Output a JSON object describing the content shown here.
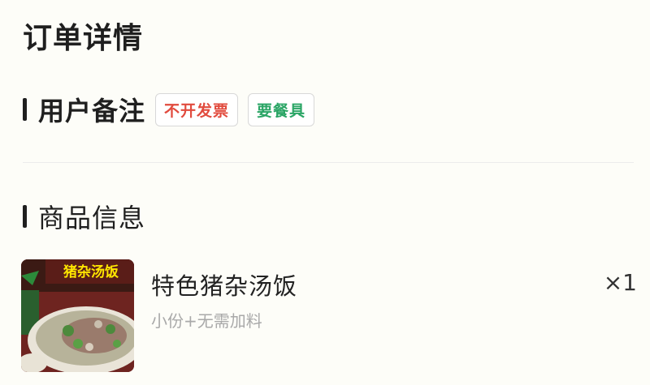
{
  "page": {
    "title": "订单详情"
  },
  "remark": {
    "title": "用户备注",
    "tags": [
      "不开发票",
      "要餐具"
    ]
  },
  "goods": {
    "title": "商品信息",
    "item": {
      "name": "特色猪杂汤饭",
      "spec": "小份+无需加料",
      "quantity": "×1",
      "image_text": "猪杂汤饭"
    }
  },
  "colors": {
    "tag_red": "#e14b3e",
    "tag_green": "#2aa565",
    "muted_text": "#a9a9a9"
  }
}
